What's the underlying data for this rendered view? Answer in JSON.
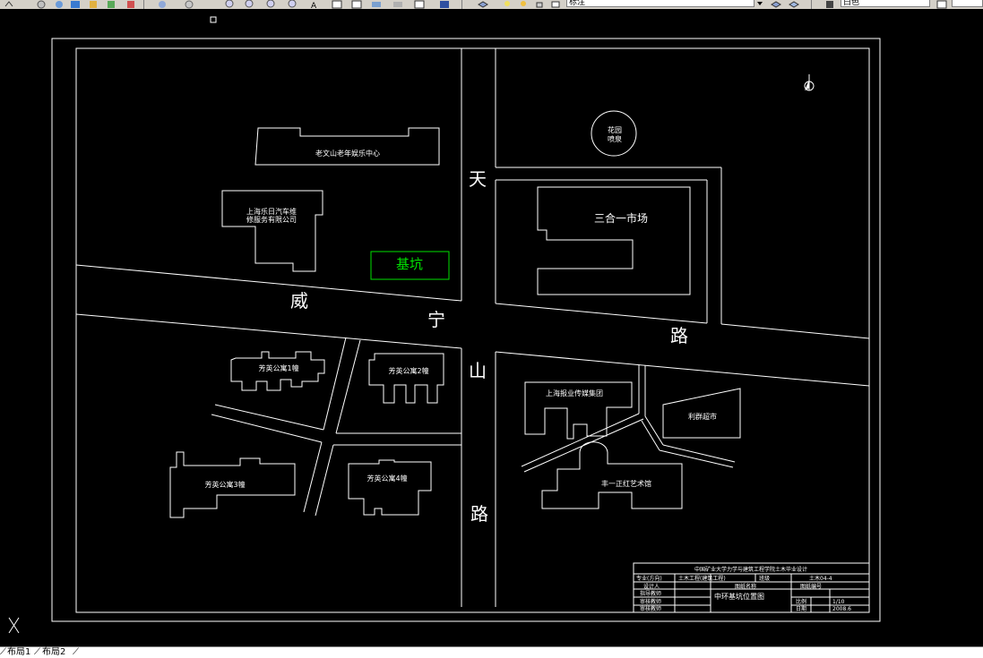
{
  "toolbar": {
    "layer_combo_value": "标注",
    "color_combo_value": "白色"
  },
  "drawing": {
    "roads": {
      "tianshan_char1": "天",
      "tianshan_char2": "山",
      "tianshan_char3": "路",
      "weining_char1": "威",
      "weining_char2": "宁",
      "weining_char3": "路"
    },
    "buildings": {
      "laowenshan": "老文山老年娱乐中心",
      "auto_line1": "上海乐日汽车维",
      "auto_line2": "修服务有限公司",
      "pit": "基坑",
      "garden_line1": "花园",
      "garden_line2": "喷泉",
      "market": "三合一市场",
      "apt1": "芳英公寓1幢",
      "apt2": "芳英公寓2幢",
      "apt3": "芳英公寓3幢",
      "apt4": "芳英公寓4幢",
      "newspaper": "上海报业传媒集团",
      "supermarket": "利群超市",
      "art": "丰一正红艺术馆"
    },
    "title_block": {
      "school": "中国矿业大学力学与建筑工程学院土木毕业设计",
      "row1_c1": "专业(方向)",
      "row1_c2": "土木工程(建筑工程)",
      "row1_c3": "班级",
      "row1_c4": "土木04-4",
      "row2_c1": "设计人",
      "row2_c2": "图纸名称",
      "row2_c3": "图纸编号",
      "row3_c1": "指导教师",
      "row4_c1": "审核教师",
      "row5_c1": "审核教师",
      "drawing_name": "中环基坑位置图",
      "scale_label": "比例",
      "scale_value": "1:500",
      "date_label": "日期",
      "date_value": "2008.6",
      "sheet_value": "1/10"
    }
  },
  "statusbar": {
    "tab1": "布局1",
    "tab2": "布局2"
  }
}
